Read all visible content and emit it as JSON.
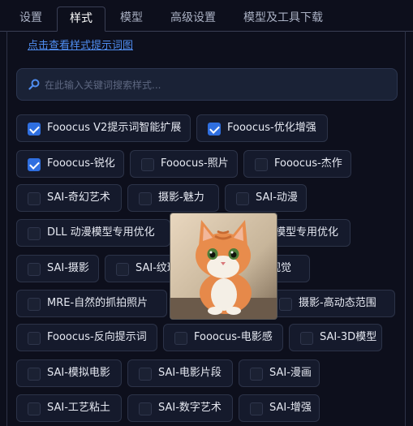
{
  "tabs": [
    "设置",
    "样式",
    "模型",
    "高级设置",
    "模型及工具下载"
  ],
  "active_tab": "样式",
  "help_link": "点击查看样式提示词图",
  "search": {
    "placeholder": "在此输入关键词搜索样式..."
  },
  "styles": [
    {
      "label": "Fooocus V2提示词智能扩展",
      "checked": true
    },
    {
      "label": "Fooocus-优化增强",
      "checked": true
    },
    {
      "label": "Fooocus-锐化",
      "checked": true
    },
    {
      "label": "Fooocus-照片",
      "checked": false
    },
    {
      "label": "Fooocus-杰作",
      "checked": false
    },
    {
      "label": "SAI-奇幻艺术",
      "checked": false
    },
    {
      "label": "摄影-魅力",
      "checked": false
    },
    {
      "label": "SAI-动漫",
      "checked": false
    },
    {
      "label": "DLL 动漫模型专用优化",
      "checked": false
    },
    {
      "label": "模型专用优化",
      "checked": false
    },
    {
      "label": "SAI-摄影",
      "checked": false
    },
    {
      "label": "SAI-纹理",
      "checked": false
    },
    {
      "label": "视觉",
      "checked": false
    },
    {
      "label": "MRE-自然的抓拍照片",
      "checked": false
    },
    {
      "label": "摄影-高动态范围",
      "checked": false
    },
    {
      "label": "Fooocus-反向提示词",
      "checked": false
    },
    {
      "label": "Fooocus-电影感",
      "checked": false
    },
    {
      "label": "SAI-3D模型",
      "checked": false
    },
    {
      "label": "SAI-模拟电影",
      "checked": false
    },
    {
      "label": "SAI-电影片段",
      "checked": false
    },
    {
      "label": "SAI-漫画",
      "checked": false
    },
    {
      "label": "SAI-工艺粘土",
      "checked": false
    },
    {
      "label": "SAI-数字艺术",
      "checked": false
    },
    {
      "label": "SAI-增强",
      "checked": false
    }
  ],
  "colors": {
    "accent": "#2f6fe0",
    "link": "#4f8df0",
    "background": "#0d0f1c"
  },
  "icons": {
    "search": "search-icon",
    "checkbox": "check-icon"
  }
}
